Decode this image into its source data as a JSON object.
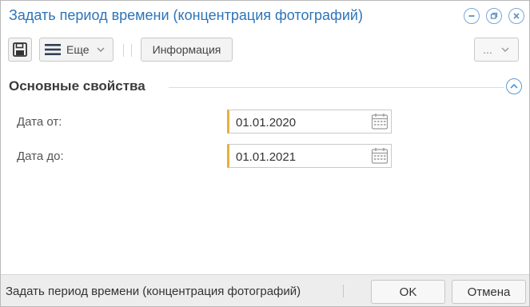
{
  "window": {
    "title": "Задать период времени (концентрация фотографий)",
    "controls": [
      {
        "icon": "minimize-icon"
      },
      {
        "icon": "restore-icon"
      },
      {
        "icon": "close-icon"
      }
    ]
  },
  "toolbar": {
    "save_icon": "floppy-disk-icon",
    "more_label": "Еще",
    "info_label": "Информация",
    "extra_label": "..."
  },
  "section": {
    "title": "Основные свойства"
  },
  "form": {
    "date_from": {
      "label": "Дата от:",
      "value": "01.01.2020"
    },
    "date_to": {
      "label": "Дата до:",
      "value": "01.01.2021"
    }
  },
  "footer": {
    "status_text": "Задать период времени (концентрация фотографий)",
    "ok_label": "OK",
    "cancel_label": "Отмена"
  },
  "colors": {
    "title": "#2d74b8",
    "accent_border": "#e5b13a",
    "footer_bg": "#ededed"
  }
}
